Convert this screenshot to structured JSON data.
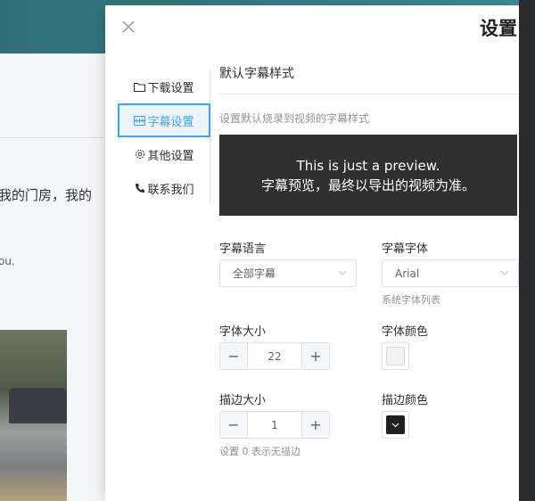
{
  "background": {
    "text_line1": "我的门房，我的",
    "text_line2": "ou."
  },
  "drawer": {
    "title": "设置",
    "close_icon": "close-icon"
  },
  "tabs": [
    {
      "label": "下载设置",
      "icon": "folder-icon"
    },
    {
      "label": "字幕设置",
      "icon": "subtitle-icon"
    },
    {
      "label": "其他设置",
      "icon": "gear-icon"
    },
    {
      "label": "联系我们",
      "icon": "phone-icon"
    }
  ],
  "subtitle": {
    "section_title": "默认字幕样式",
    "description": "设置默认烧录到视频的字幕样式",
    "preview_line1": "This is just a preview.",
    "preview_line2": "字幕预览，最终以导出的视频为准。",
    "language": {
      "label": "字幕语言",
      "value": "全部字幕"
    },
    "font": {
      "label": "字幕字体",
      "value": "Arial",
      "hint": "系统字体列表"
    },
    "font_size": {
      "label": "字体大小",
      "value": "22"
    },
    "font_color": {
      "label": "字体颜色",
      "color": "#f2f2f2"
    },
    "stroke_size": {
      "label": "描边大小",
      "value": "1",
      "hint": "设置 0 表示无描边"
    },
    "stroke_color": {
      "label": "描边颜色",
      "color": "#1f1f1f"
    }
  },
  "colors": {
    "accent": "#409eff",
    "preview_bg": "#303030"
  }
}
